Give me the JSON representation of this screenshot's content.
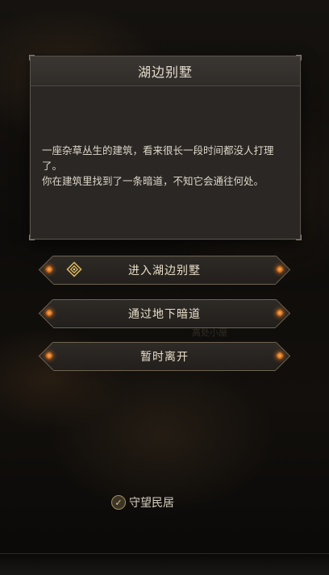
{
  "background": {
    "faint_label": "高处小屋"
  },
  "dialog": {
    "title": "湖边别墅",
    "paragraphs": [
      "一座杂草丛生的建筑，看来很长一段时间都没人打理了。",
      "你在建筑里找到了一条暗道，不知它会通往何处。"
    ]
  },
  "choices": [
    {
      "label": "进入湖边别墅",
      "icon": "rune-icon"
    },
    {
      "label": "通过地下暗道"
    },
    {
      "label": "暂时离开"
    }
  ],
  "location": {
    "label": "守望民居",
    "icon": "check-icon"
  },
  "colors": {
    "accent_gold": "#a58f56",
    "gem_orange": "#e07a25",
    "panel": "#2a2724"
  }
}
